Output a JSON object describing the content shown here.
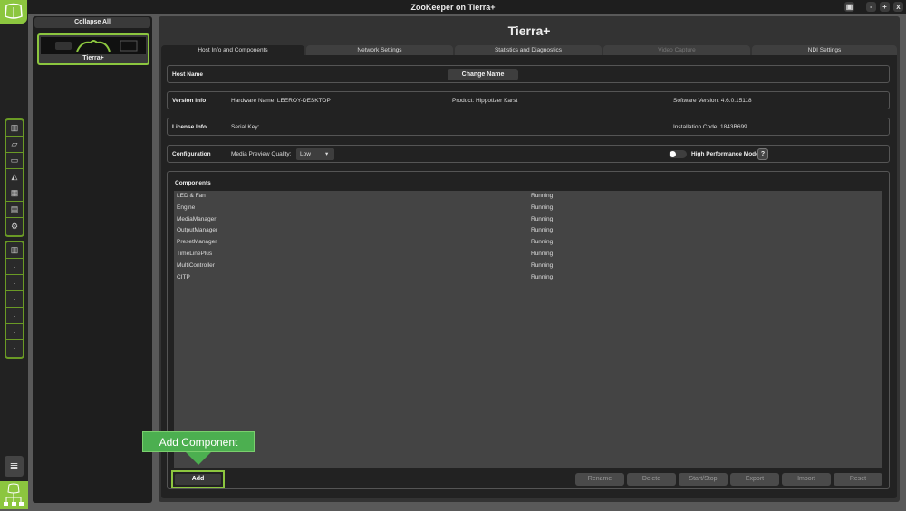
{
  "window": {
    "title": "ZooKeeper on Tierra+",
    "buttons": [
      "▣",
      "-",
      "+",
      "x"
    ]
  },
  "sidebar": {
    "collapse_label": "Collapse All",
    "hosts": [
      {
        "name": "Tierra+"
      }
    ]
  },
  "page": {
    "title": "Tierra+"
  },
  "tabs": [
    {
      "label": "Host Info and Components",
      "active": true
    },
    {
      "label": "Network Settings"
    },
    {
      "label": "Statistics and Diagnostics"
    },
    {
      "label": "Video Capture",
      "disabled": true
    },
    {
      "label": "NDI Settings"
    }
  ],
  "host": {
    "label": "Host Name",
    "change_name": "Change Name"
  },
  "version": {
    "label": "Version Info",
    "hardware": "Hardware Name: LEEROY-DESKTOP",
    "product": "Product: Hippotizer Karst",
    "software": "Software Version: 4.6.0.15118"
  },
  "license": {
    "label": "License Info",
    "serial": "Serial Key:",
    "install": "Installation Code: 1843B699"
  },
  "config": {
    "label": "Configuration",
    "quality_label": "Media Preview Quality:",
    "quality_value": "Low",
    "perf_label": "High Performance Mode",
    "perf_on": false,
    "help": "?"
  },
  "components": {
    "label": "Components",
    "items": [
      {
        "name": "LED & Fan",
        "status": "Running"
      },
      {
        "name": "Engine",
        "status": "Running"
      },
      {
        "name": "MediaManager",
        "status": "Running"
      },
      {
        "name": "OutputManager",
        "status": "Running"
      },
      {
        "name": "PresetManager",
        "status": "Running"
      },
      {
        "name": "TimeLinePlus",
        "status": "Running"
      },
      {
        "name": "MultiController",
        "status": "Running"
      },
      {
        "name": "CITP",
        "status": "Running"
      }
    ]
  },
  "actions": {
    "add": "Add",
    "rename": "Rename",
    "delete": "Delete",
    "startstop": "Start/Stop",
    "export": "Export",
    "import": "Import",
    "reset": "Reset"
  },
  "tooltip": "Add Component"
}
